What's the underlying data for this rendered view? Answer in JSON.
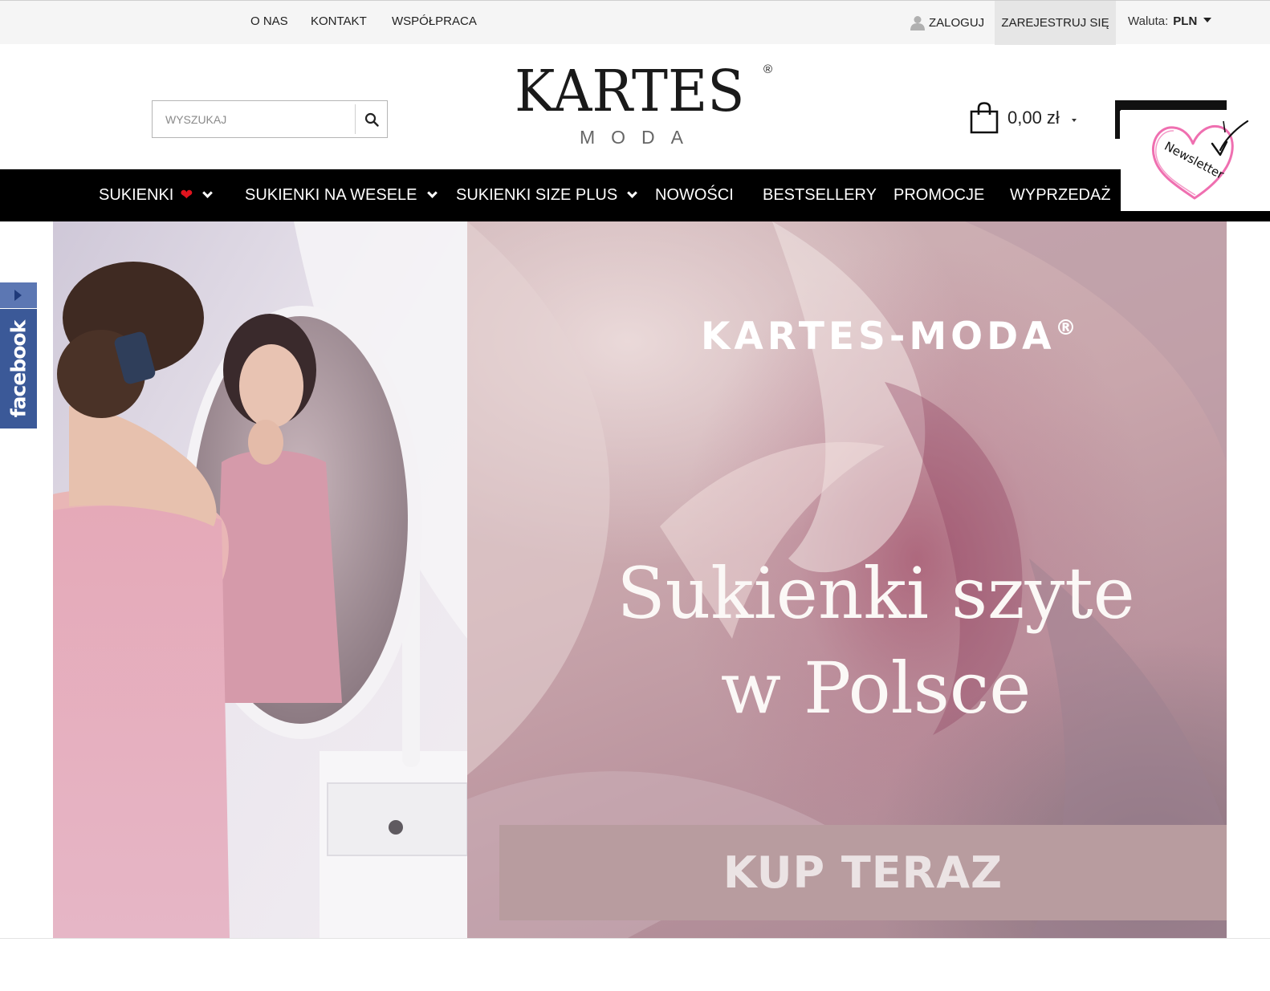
{
  "topbar": {
    "links": [
      "O NAS",
      "KONTAKT",
      "WSPÓŁPRACA"
    ],
    "login_label": "ZALOGUJ",
    "register_label": "ZAREJESTRUJ SIĘ",
    "currency_label": "Waluta:",
    "currency_value": "PLN"
  },
  "header": {
    "search_placeholder": "WYSZUKAJ",
    "logo_main": "KARTES",
    "logo_registered": "®",
    "logo_sub": "MODA",
    "cart_total": "0,00 zł",
    "newsletter_label": "Newsletter"
  },
  "nav": {
    "items": [
      {
        "label": "SUKIENKI",
        "has_dropdown": true,
        "heart": true
      },
      {
        "label": "SUKIENKI NA WESELE",
        "has_dropdown": true
      },
      {
        "label": "SUKIENKI SIZE PLUS",
        "has_dropdown": true
      },
      {
        "label": "NOWOŚCI",
        "has_dropdown": false
      },
      {
        "label": "BESTSELLERY",
        "has_dropdown": false
      },
      {
        "label": "PROMOCJE",
        "has_dropdown": false
      },
      {
        "label": "WYPRZEDAŻ",
        "has_dropdown": false
      }
    ]
  },
  "hero": {
    "brand": "KARTES-MODA",
    "brand_registered": "®",
    "title_line1": "Sukienki szyte",
    "title_line2": "w Polsce",
    "cta_label": "KUP TERAZ"
  },
  "social": {
    "facebook_label": "facebook"
  },
  "colors": {
    "nav_bg": "#000000",
    "cta_bg": "#b89c9f",
    "facebook": "#3b5998",
    "heart": "#e0141e",
    "newsletter_heart": "#ef6fb0"
  }
}
